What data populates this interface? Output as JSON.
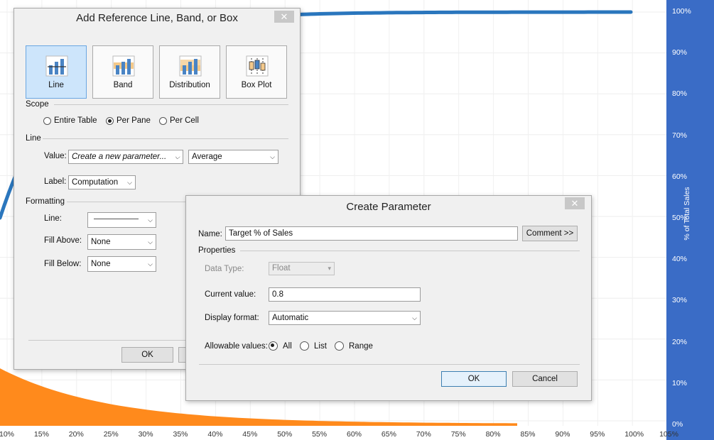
{
  "chart": {
    "y_axis_title": "% of Total Sales",
    "y_ticks": [
      "100%",
      "90%",
      "80%",
      "70%",
      "60%",
      "50%",
      "40%",
      "30%",
      "20%",
      "10%",
      "0%"
    ],
    "x_ticks": [
      "10%",
      "15%",
      "20%",
      "25%",
      "30%",
      "35%",
      "40%",
      "45%",
      "50%",
      "55%",
      "60%",
      "65%",
      "70%",
      "75%",
      "80%",
      "85%",
      "90%",
      "95%",
      "100%",
      "105%"
    ],
    "line_color": "#2a76bd",
    "area_color": "#ff8a1c",
    "axis_band_color": "#3a6cc6"
  },
  "ref_dialog": {
    "title": "Add Reference Line, Band, or Box",
    "close_glyph": "✕",
    "types": [
      {
        "label": "Line",
        "icon": "line-chart-icon",
        "selected": true
      },
      {
        "label": "Band",
        "icon": "band-chart-icon",
        "selected": false
      },
      {
        "label": "Distribution",
        "icon": "distribution-chart-icon",
        "selected": false
      },
      {
        "label": "Box Plot",
        "icon": "box-plot-icon",
        "selected": false
      }
    ],
    "scope": {
      "label": "Scope",
      "options": [
        {
          "label": "Entire Table",
          "checked": false
        },
        {
          "label": "Per Pane",
          "checked": true
        },
        {
          "label": "Per Cell",
          "checked": false
        }
      ]
    },
    "line": {
      "section_label": "Line",
      "value_label": "Value:",
      "value_field": "Create a new parameter...",
      "aggregation": "Average",
      "label_label": "Label:",
      "label_value": "Computation"
    },
    "formatting": {
      "section_label": "Formatting",
      "line_label": "Line:",
      "fill_above_label": "Fill Above:",
      "fill_above_value": "None",
      "fill_below_label": "Fill Below:",
      "fill_below_value": "None"
    },
    "ok_label": "OK"
  },
  "param_dialog": {
    "title": "Create Parameter",
    "close_glyph": "✕",
    "name_label": "Name:",
    "name_value": "Target % of Sales",
    "comment_button": "Comment >>",
    "properties_label": "Properties",
    "data_type_label": "Data Type:",
    "data_type_value": "Float",
    "current_value_label": "Current value:",
    "current_value": "0.8",
    "display_format_label": "Display format:",
    "display_format_value": "Automatic",
    "allowable_label": "Allowable values:",
    "allowable_options": [
      {
        "label": "All",
        "checked": true
      },
      {
        "label": "List",
        "checked": false
      },
      {
        "label": "Range",
        "checked": false
      }
    ],
    "ok_label": "OK",
    "cancel_label": "Cancel"
  }
}
